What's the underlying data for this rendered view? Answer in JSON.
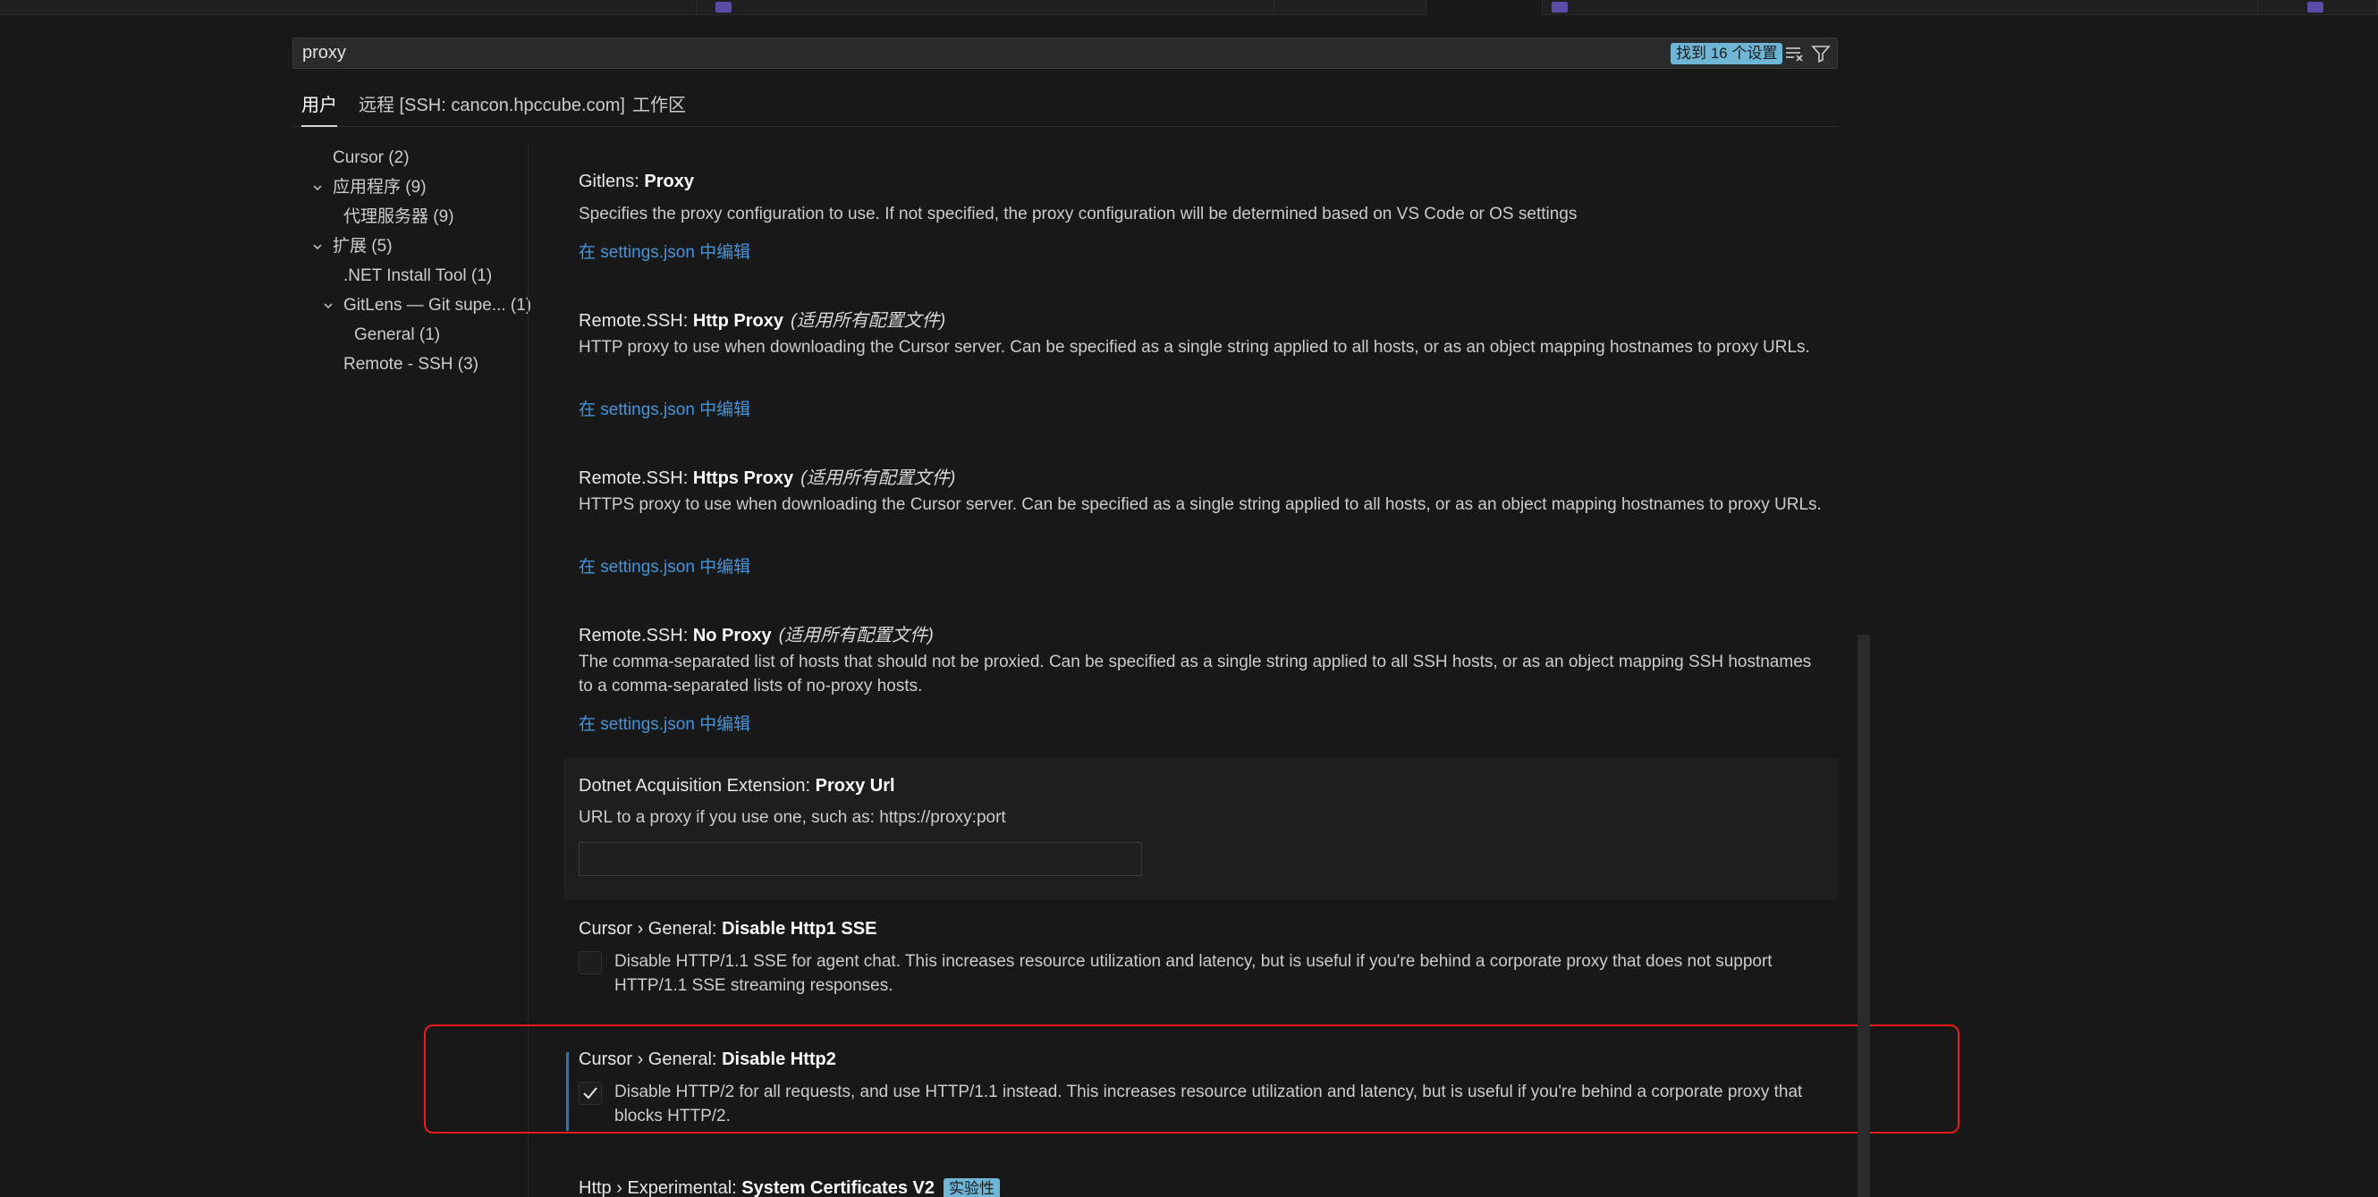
{
  "search": {
    "value": "proxy",
    "result_count": "找到 16 个设置"
  },
  "scope_tabs": [
    {
      "label": "用户"
    },
    {
      "label": "远程 [SSH: cancon.hpccube.com]"
    },
    {
      "label": "工作区"
    }
  ],
  "toc": [
    {
      "label": "Cursor",
      "count": "(2)"
    },
    {
      "label": "应用程序",
      "count": "(9)"
    },
    {
      "label": "代理服务器",
      "count": "(9)"
    },
    {
      "label": "扩展",
      "count": "(5)"
    },
    {
      "label": ".NET Install Tool",
      "count": "(1)"
    },
    {
      "label": "GitLens — Git supe...",
      "count": "(1)"
    },
    {
      "label": "General",
      "count": "(1)"
    },
    {
      "label": "Remote - SSH",
      "count": "(3)"
    }
  ],
  "settings": [
    {
      "prefix": "Gitlens: ",
      "name": "Proxy",
      "scope": "",
      "desc": "Specifies the proxy configuration to use. If not specified, the proxy configuration will be determined based on VS Code or OS settings",
      "link": "在 settings.json 中编辑"
    },
    {
      "prefix": "Remote.SSH: ",
      "name": "Http Proxy",
      "scope": "(适用所有配置文件)",
      "desc": "HTTP proxy to use when downloading the Cursor server. Can be specified as a single string applied to all hosts, or as an object mapping hostnames to proxy URLs.",
      "link": "在 settings.json 中编辑"
    },
    {
      "prefix": "Remote.SSH: ",
      "name": "Https Proxy",
      "scope": "(适用所有配置文件)",
      "desc": "HTTPS proxy to use when downloading the Cursor server. Can be specified as a single string applied to all hosts, or as an object mapping hostnames to proxy URLs.",
      "link": "在 settings.json 中编辑"
    },
    {
      "prefix": "Remote.SSH: ",
      "name": "No Proxy",
      "scope": "(适用所有配置文件)",
      "desc": "The comma-separated list of hosts that should not be proxied. Can be specified as a single string applied to all SSH hosts, or as an object mapping SSH hostnames to a comma-separated lists of no-proxy hosts.",
      "link": "在 settings.json 中编辑"
    },
    {
      "prefix": "Dotnet Acquisition Extension: ",
      "name": "Proxy Url",
      "scope": "",
      "desc": "URL to a proxy if you use one, such as: https://proxy:port",
      "value": ""
    },
    {
      "prefix": "Cursor › General: ",
      "name": "Disable Http1 SSE",
      "scope": "",
      "desc": "Disable HTTP/1.1 SSE for agent chat. This increases resource utilization and latency, but is useful if you're behind a corporate proxy that does not support HTTP/1.1 SSE streaming responses.",
      "checked": false
    },
    {
      "prefix": "Cursor › General: ",
      "name": "Disable Http2",
      "scope": "",
      "desc": "Disable HTTP/2 for all requests, and use HTTP/1.1 instead. This increases resource utilization and latency, but is useful if you're behind a corporate proxy that blocks HTTP/2.",
      "checked": true
    },
    {
      "prefix": "Http › Experimental: ",
      "name": "System Certificates V2",
      "badge": "实验性"
    }
  ]
}
